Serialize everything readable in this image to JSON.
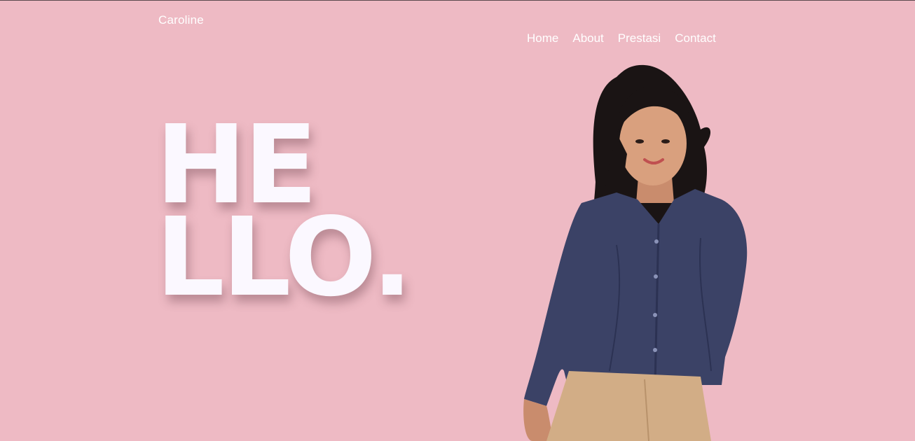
{
  "brand": {
    "name": "Caroline"
  },
  "nav": {
    "items": [
      "Home",
      "About",
      "Prestasi",
      "Contact"
    ]
  },
  "hero": {
    "line1": "HE",
    "line2": "LLO."
  },
  "colors": {
    "background": "#eebac4",
    "text": "#ffffff",
    "hero_text": "#fbf8ff",
    "shirt": "#3b4266",
    "skirt": "#d2ad86",
    "hair": "#1a1414",
    "skin": "#d9a07e"
  },
  "portrait": {
    "icon": "person-photo"
  }
}
